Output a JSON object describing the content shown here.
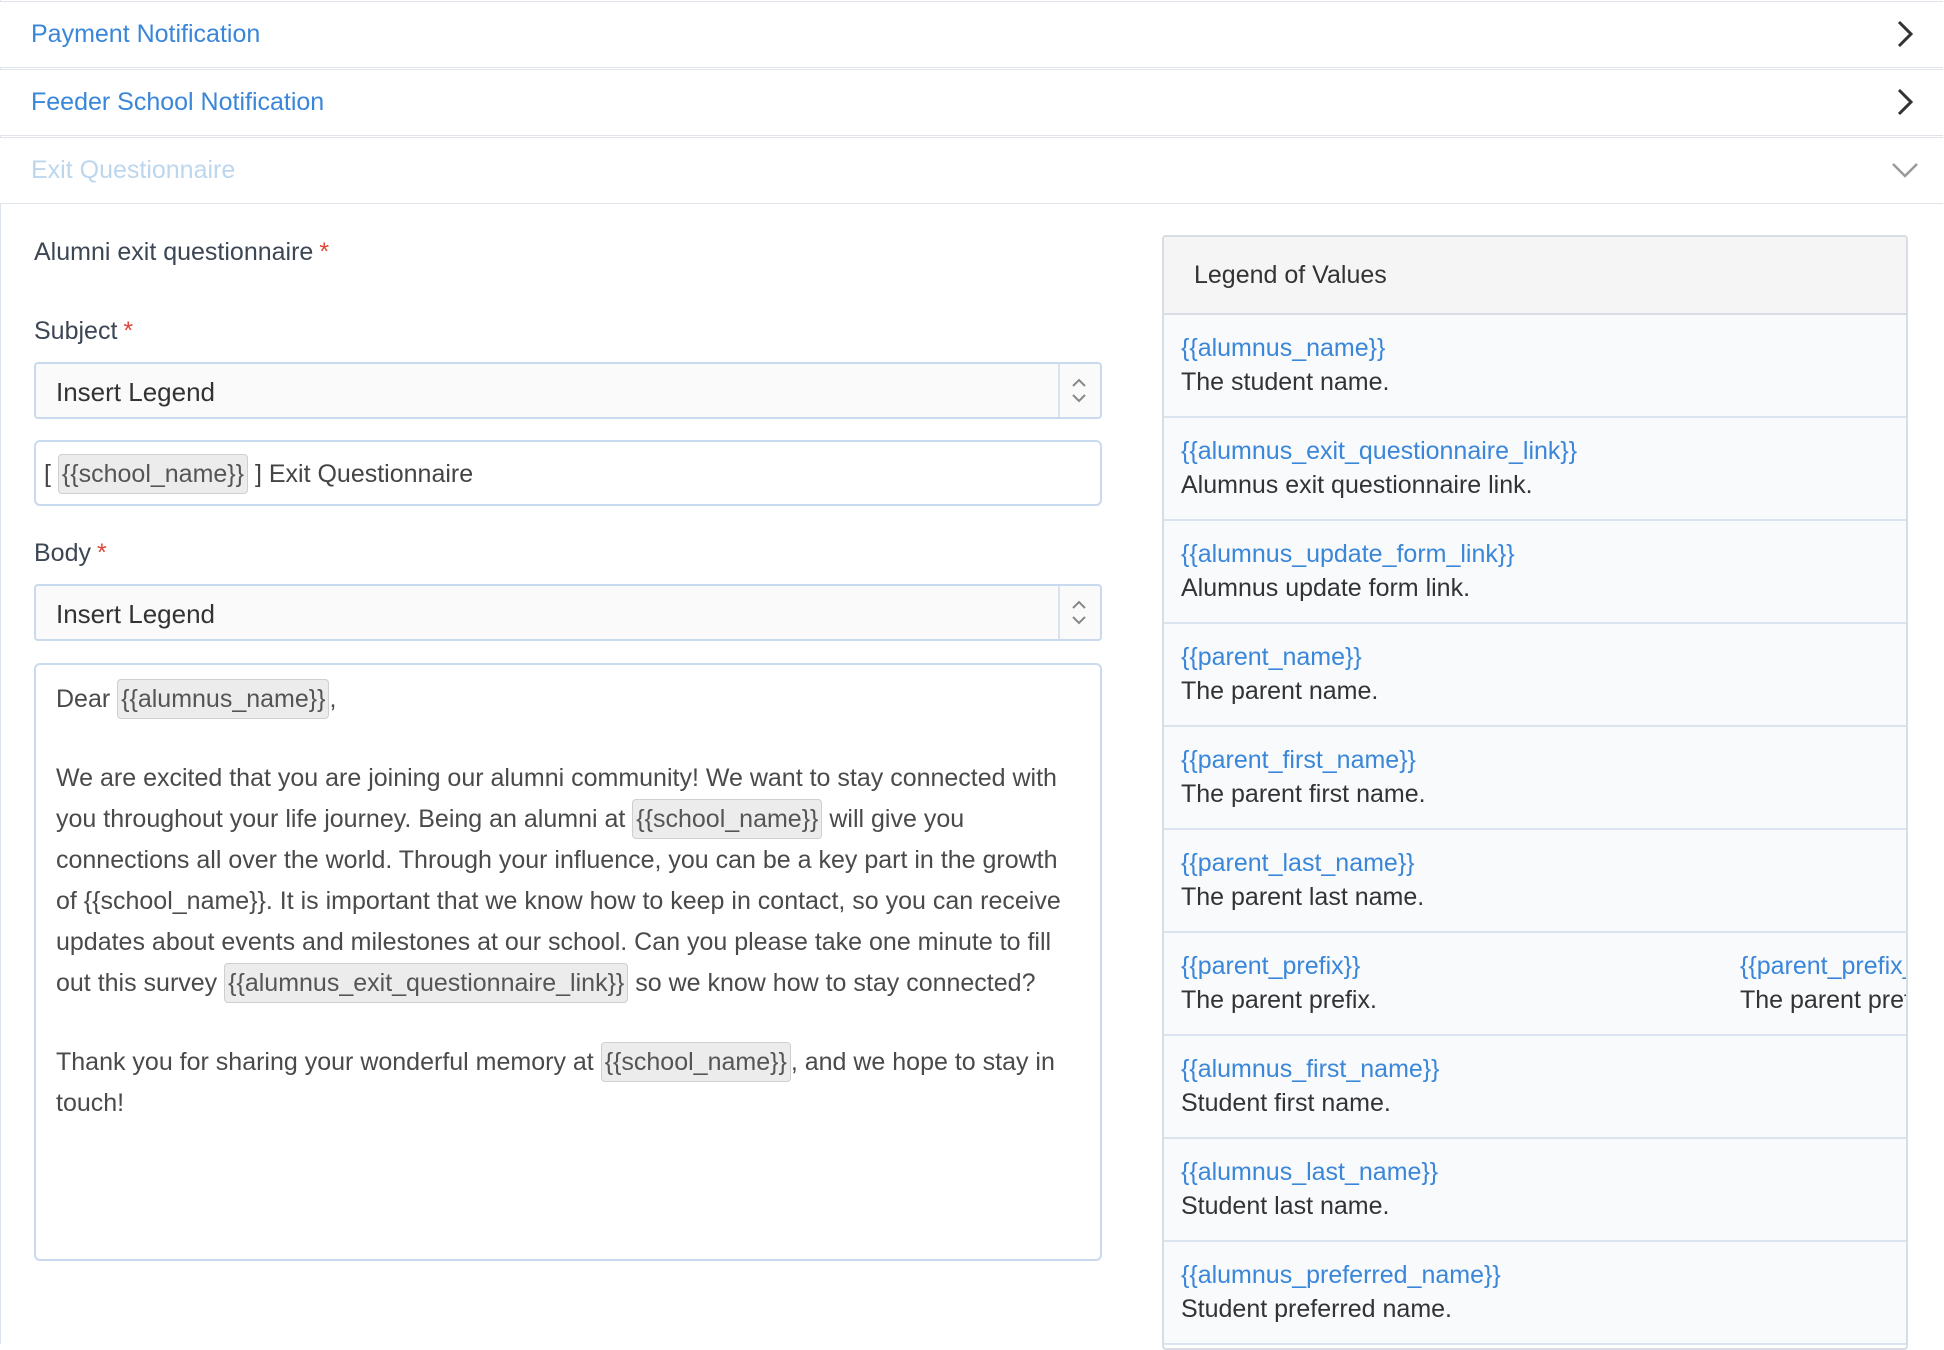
{
  "accordion": [
    {
      "title": "Payment Notification",
      "state": "collapsed"
    },
    {
      "title": "Feeder School Notification",
      "state": "collapsed"
    },
    {
      "title": "Exit Questionnaire",
      "state": "expanded"
    }
  ],
  "form": {
    "section_label": "Alumni exit questionnaire",
    "required_mark": "*",
    "subject_label": "Subject",
    "subject_select": "Insert Legend",
    "subject_prefix": "[",
    "subject_chip": "{{school_name}}",
    "subject_suffix": "] Exit Questionnaire",
    "body_label": "Body",
    "body_select": "Insert Legend",
    "body": {
      "greeting_word": "Dear",
      "greeting_chip": "{{alumnus_name}}",
      "greeting_comma": ",",
      "p1_a": "We are excited that you are joining our alumni community! We want to stay connected with you throughout your life journey. Being an alumni at",
      "p1_chip1": "{{school_name}}",
      "p1_b": "will give you connections all over the world. Through your influence, you can be a key part in the growth of {{school_name}}. It is important that we know how to keep in contact, so you can receive updates about events and milestones at our school. Can you please take one minute to fill out this survey",
      "p1_chip2": "{{alumnus_exit_questionnaire_link}}",
      "p1_c": "so we know how to stay connected?",
      "p2_a": "Thank you for sharing your wonderful memory at",
      "p2_chip": "{{school_name}}",
      "p2_b": ", and we hope to stay in touch!"
    }
  },
  "legend": {
    "title": "Legend of Values",
    "items": [
      {
        "key": "{{alumnus_name}}",
        "desc": "The student name."
      },
      {
        "key": "{{alumnus_exit_questionnaire_link}}",
        "desc": "Alumnus exit questionnaire link."
      },
      {
        "key": "{{alumnus_update_form_link}}",
        "desc": "Alumnus update form link."
      },
      {
        "key": "{{parent_name}}",
        "desc": "The parent name."
      },
      {
        "key": "{{parent_first_name}}",
        "desc": "The parent first name."
      },
      {
        "key": "{{parent_last_name}}",
        "desc": "The parent last name."
      },
      {
        "key": "{{parent_prefix}}",
        "desc": "The parent prefix.",
        "key2": "{{parent_prefix_",
        "desc2": "The parent pref"
      },
      {
        "key": "{{alumnus_first_name}}",
        "desc": "Student first name."
      },
      {
        "key": "{{alumnus_last_name}}",
        "desc": "Student last name."
      },
      {
        "key": "{{alumnus_preferred_name}}",
        "desc": "Student preferred name."
      }
    ]
  },
  "colors": {
    "link": "#3a86d8",
    "required": "#e0463a",
    "border": "#c9daef"
  },
  "icons": [
    "chevron-right-icon",
    "chevron-down-icon",
    "select-arrows-icon"
  ]
}
